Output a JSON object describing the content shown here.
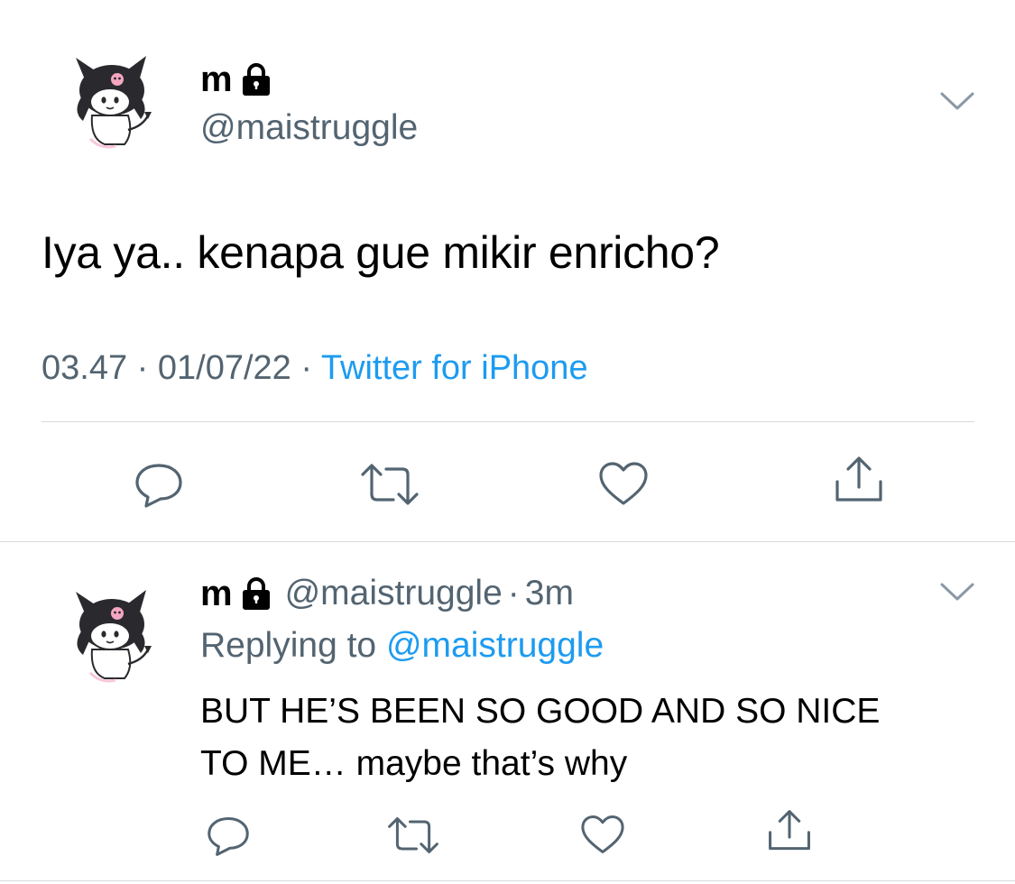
{
  "main_tweet": {
    "display_name": "m",
    "handle": "@maistruggle",
    "text": "Iya ya.. kenapa gue mikir enricho?",
    "time": "03.47",
    "date": "01/07/22",
    "separator": "·",
    "source": "Twitter for iPhone",
    "icons": {
      "avatar": "kuromi-avatar",
      "lock": "lock-icon",
      "menu": "chevron-down-icon"
    },
    "actions": [
      "reply-icon",
      "retweet-icon",
      "like-icon",
      "share-icon"
    ]
  },
  "reply_tweet": {
    "display_name": "m",
    "handle": "@maistruggle",
    "separator": "·",
    "time_ago": "3m",
    "replying_prefix": "Replying to",
    "replying_to": "@maistruggle",
    "text_line1": "BUT HE’S BEEN SO GOOD AND SO NICE",
    "text_line2": "TO ME… maybe that’s why",
    "actions": [
      "reply-icon",
      "retweet-icon",
      "like-icon",
      "share-icon"
    ]
  },
  "colors": {
    "text": "#000000",
    "secondary": "#536471",
    "link": "#1d9bf0",
    "divider": "#d6dbdf"
  }
}
